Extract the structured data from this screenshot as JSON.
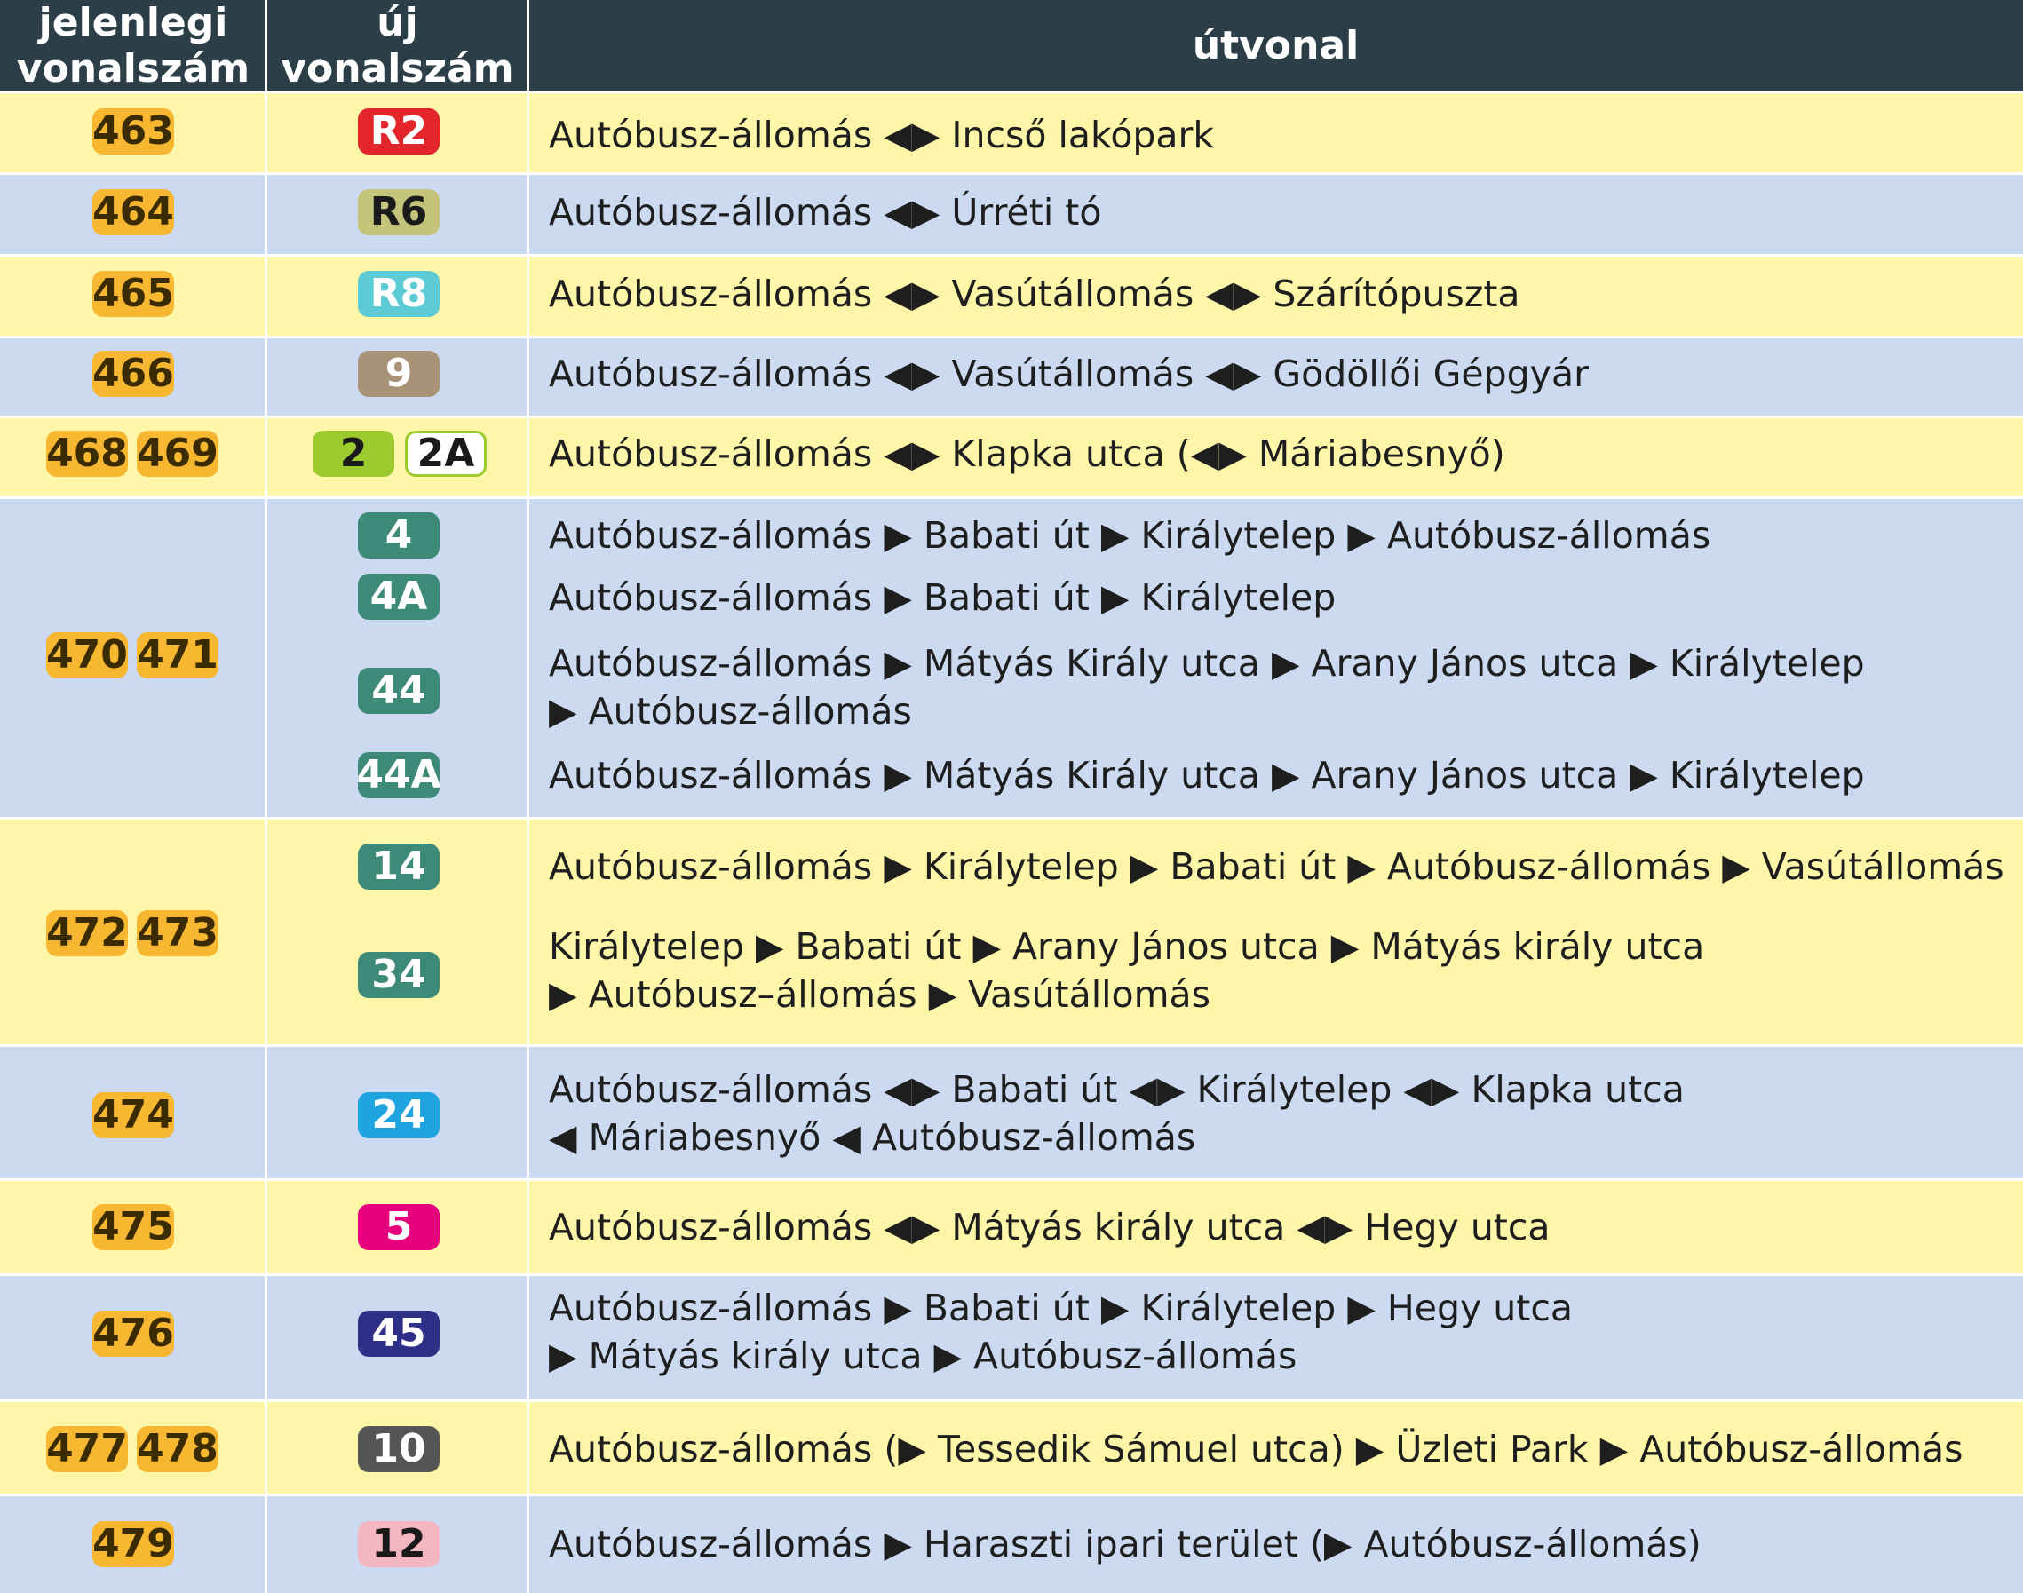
{
  "header": {
    "col1": "jelenlegi\nvonalszám",
    "col2": "új\nvonalszám",
    "col3": "útvonal"
  },
  "rows": [
    {
      "old": [
        "463"
      ],
      "routes": [
        {
          "code": "R2",
          "text": "Autóbusz-állomás ◀▶ Incső lakópark"
        }
      ]
    },
    {
      "old": [
        "464"
      ],
      "routes": [
        {
          "code": "R6",
          "text": "Autóbusz-állomás ◀▶ Úrréti tó"
        }
      ]
    },
    {
      "old": [
        "465"
      ],
      "routes": [
        {
          "code": "R8",
          "text": "Autóbusz-állomás ◀▶ Vasútállomás ◀▶ Szárítópuszta"
        }
      ]
    },
    {
      "old": [
        "466"
      ],
      "routes": [
        {
          "code": "9",
          "text": "Autóbusz-állomás ◀▶ Vasútállomás ◀▶ Gödöllői Gépgyár"
        }
      ]
    },
    {
      "old": [
        "468",
        "469"
      ],
      "routes": [
        {
          "code": "2",
          "code2": "2A",
          "text": "Autóbusz-állomás ◀▶ Klapka utca (◀▶ Máriabesnyő)"
        }
      ]
    },
    {
      "old": [
        "470",
        "471"
      ],
      "routes": [
        {
          "code": "4",
          "text": "Autóbusz-állomás ▶ Babati út ▶ Királytelep ▶ Autóbusz-állomás"
        },
        {
          "code": "4A",
          "text": "Autóbusz-állomás ▶ Babati út ▶ Királytelep"
        },
        {
          "code": "44",
          "text": "Autóbusz-állomás ▶ Mátyás Király utca ▶ Arany János utca ▶ Királytelep\n▶ Autóbusz-állomás"
        },
        {
          "code": "44A",
          "text": "Autóbusz-állomás ▶ Mátyás Király utca ▶ Arany János utca ▶ Királytelep"
        }
      ]
    },
    {
      "old": [
        "472",
        "473"
      ],
      "routes": [
        {
          "code": "14",
          "text": "Autóbusz-állomás ▶ Királytelep ▶ Babati út ▶ Autóbusz-állomás ▶ Vasútállomás"
        },
        {
          "code": "34",
          "text": "Királytelep ▶ Babati út ▶ Arany János utca ▶ Mátyás király utca\n▶ Autóbusz–állomás ▶ Vasútállomás"
        }
      ]
    },
    {
      "old": [
        "474"
      ],
      "routes": [
        {
          "code": "24",
          "text": "Autóbusz-állomás ◀▶ Babati út ◀▶ Királytelep ◀▶ Klapka utca\n◀ Máriabesnyő ◀ Autóbusz-állomás"
        }
      ]
    },
    {
      "old": [
        "475"
      ],
      "routes": [
        {
          "code": "5",
          "text": "Autóbusz-állomás ◀▶ Mátyás király utca ◀▶ Hegy utca"
        }
      ]
    },
    {
      "old": [
        "476"
      ],
      "routes": [
        {
          "code": "45",
          "text": "Autóbusz-állomás ▶ Babati út ▶ Királytelep ▶ Hegy utca\n▶ Mátyás király utca ▶ Autóbusz-állomás"
        }
      ]
    },
    {
      "old": [
        "477",
        "478"
      ],
      "routes": [
        {
          "code": "10",
          "text": "Autóbusz-állomás (▶ Tessedik Sámuel utca) ▶ Üzleti Park ▶ Autóbusz-állomás"
        }
      ]
    },
    {
      "old": [
        "479"
      ],
      "routes": [
        {
          "code": "12",
          "text": "Autóbusz-állomás ▶ Haraszti ipari terület (▶ Autóbusz-állomás)"
        }
      ]
    }
  ],
  "colors": {
    "header_bg": "#2c3e47",
    "row_yellow": "#fdf5a8",
    "row_blue": "#cbdaf1",
    "old_pill": "#f7b731",
    "R2": "#e3262b",
    "R6": "#c3c47a",
    "R8": "#5ccbd6",
    "9": "#a89278",
    "2": "#9ccb2d",
    "2A": "#ffffff",
    "4": "#3e8a78",
    "4A": "#3e8a78",
    "44": "#3e8a78",
    "44A": "#3e8a78",
    "14": "#3e8a78",
    "34": "#3e8a78",
    "24": "#1ea5e0",
    "5": "#e6007e",
    "45": "#2e2f86",
    "10": "#555555",
    "12": "#f4b6bf"
  }
}
